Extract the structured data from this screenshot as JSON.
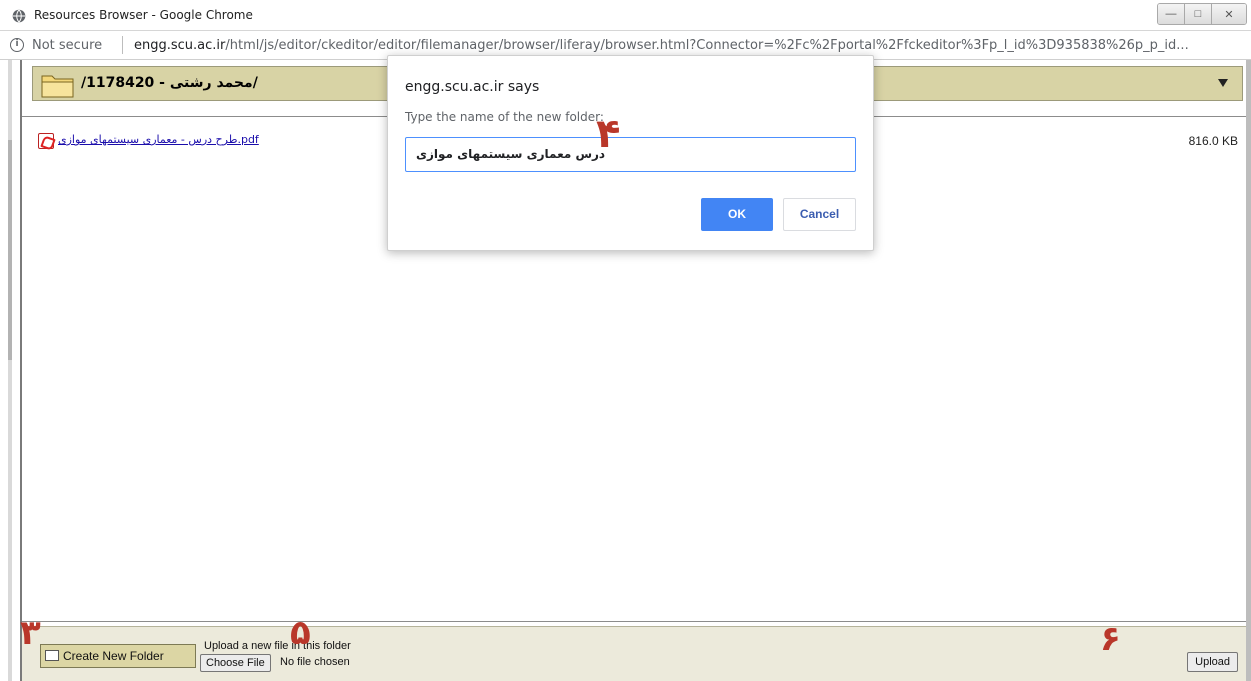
{
  "window": {
    "title": "Resources Browser - Google Chrome"
  },
  "addressbar": {
    "security_label": "Not secure",
    "url_host": "engg.scu.ac.ir",
    "url_path": "/html/js/editor/ckeditor/editor/filemanager/browser/liferay/browser.html?Connector=%2Fc%2Fportal%2Ffckeditor%3Fp_l_id%3D935838%26p_p_id..."
  },
  "pathbar": {
    "path": "/1178420 - محمد رشتی/"
  },
  "files": [
    {
      "name": "طرح درس - معماری سیستمهای موازی.pdf",
      "size": "816.0 KB"
    }
  ],
  "dialog": {
    "title": "engg.scu.ac.ir says",
    "message": "Type the name of the new folder:",
    "input_value": "درس معماری سیستمهای موازی",
    "ok_label": "OK",
    "cancel_label": "Cancel"
  },
  "bottombar": {
    "create_folder_label": "Create New Folder",
    "upload_label": "Upload a new file in this folder",
    "choose_file_label": "Choose File",
    "no_file_label": "No file chosen",
    "upload_button_label": "Upload"
  },
  "annotations": {
    "step3": "۳",
    "step4": "۴",
    "step5": "۵",
    "step6": "۶"
  },
  "colors": {
    "path_bg": "#d8d3a5",
    "dialog_ok": "#4285f4",
    "annotation": "#b9372a",
    "link": "#1a0dab"
  }
}
